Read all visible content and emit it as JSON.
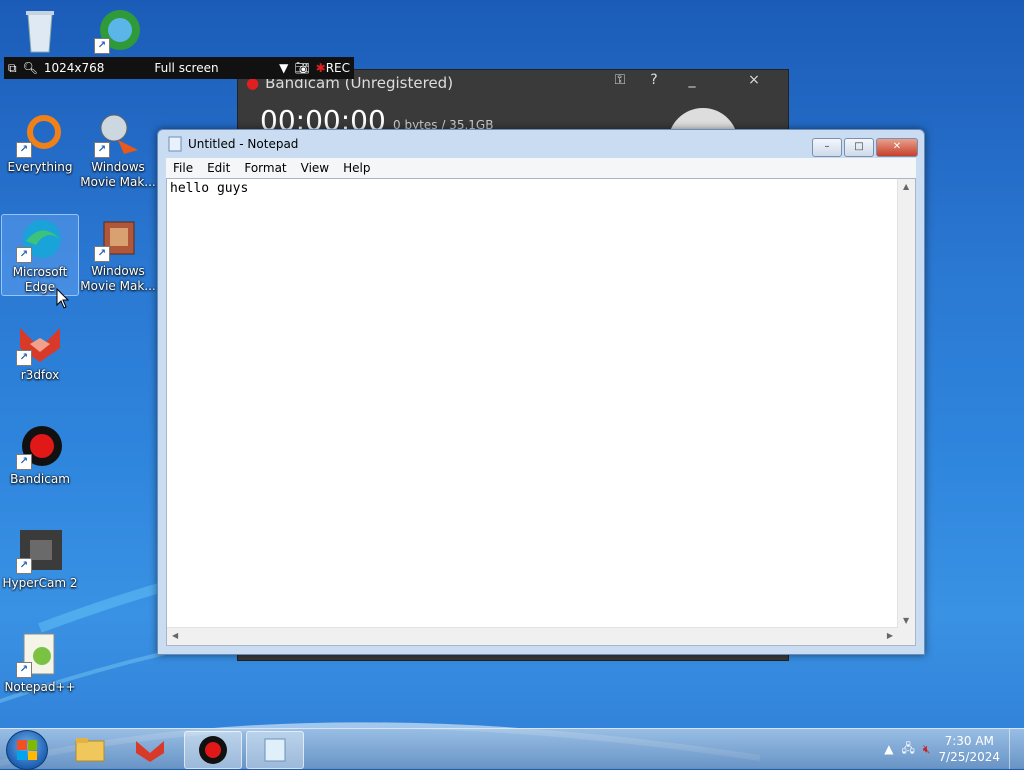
{
  "desktop": {
    "icons": [
      {
        "label": ""
      },
      {
        "label": ""
      },
      {
        "label": "Everything"
      },
      {
        "label": "Windows Movie Mak..."
      },
      {
        "label": "Microsoft Edge"
      },
      {
        "label": "Windows Movie Mak..."
      },
      {
        "label": "r3dfox"
      },
      {
        "label": "Bandicam"
      },
      {
        "label": "HyperCam 2"
      },
      {
        "label": "Notepad++"
      }
    ]
  },
  "bandicam_toolbar": {
    "resolution": "1024x768",
    "mode": "Full screen",
    "rec_label": "REC"
  },
  "bandicam_window": {
    "title": "Bandicam (Unregistered)",
    "timer": "00:00:00",
    "bytes": "0 bytes / 35.1GB",
    "help": "?",
    "minimize": "_",
    "close": "×"
  },
  "notepad": {
    "title": "Untitled - Notepad",
    "menu": [
      "File",
      "Edit",
      "Format",
      "View",
      "Help"
    ],
    "content": "hello guys",
    "btn_minimize": "–",
    "btn_maximize": "□",
    "btn_close": "✕"
  },
  "taskbar": {
    "time": "7:30 AM",
    "date": "7/25/2024"
  },
  "colors": {
    "desktop_blue": "#2a78d2",
    "taskbar": "#8cb0d4",
    "window_frame": "#c9dcf1"
  }
}
